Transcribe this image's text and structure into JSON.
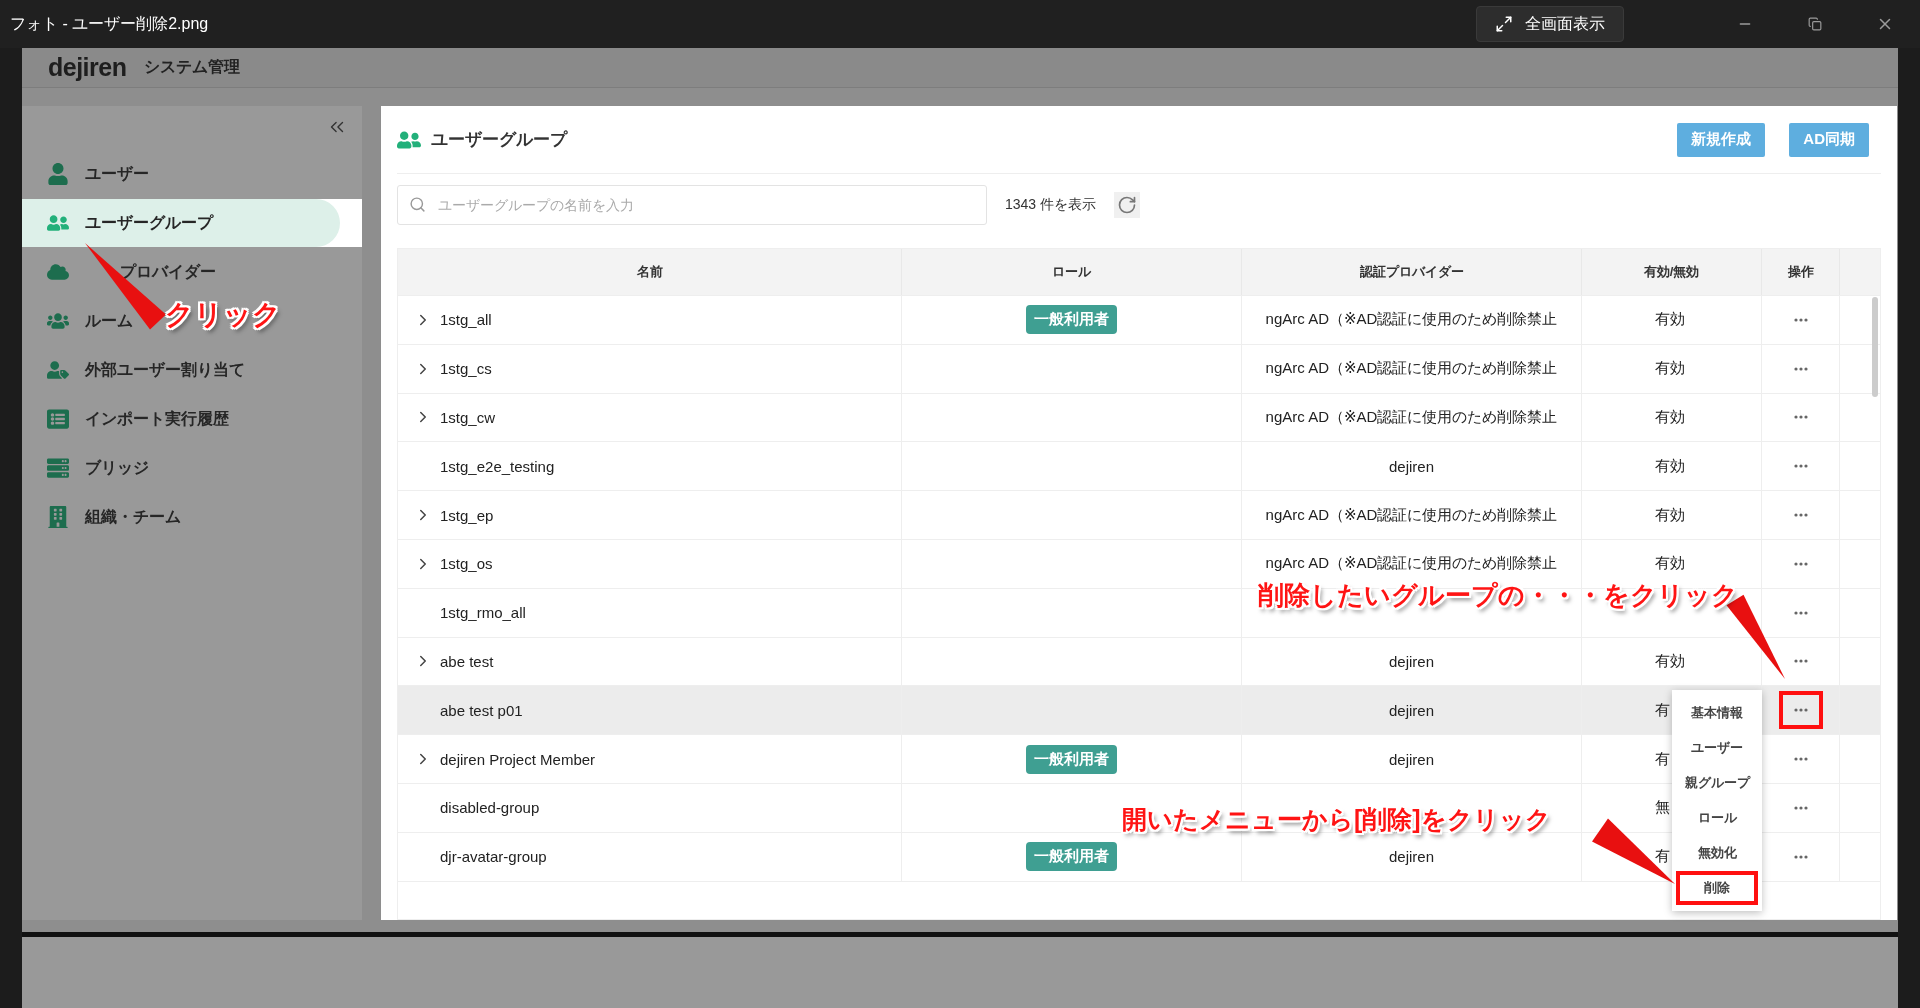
{
  "window": {
    "title": "フォト - ユーザー削除2.png",
    "fullscreen_button": "全画面表示"
  },
  "app": {
    "logo": "dejiren",
    "section": "システム管理"
  },
  "sidebar": {
    "items": [
      {
        "label": "ユーザー",
        "selected": false
      },
      {
        "label": "ユーザーグループ",
        "selected": true
      },
      {
        "label": "プロバイダー",
        "selected": false
      },
      {
        "label": "ルーム",
        "selected": false
      },
      {
        "label": "外部ユーザー割り当て",
        "selected": false
      },
      {
        "label": "インポート実行履歴",
        "selected": false
      },
      {
        "label": "ブリッジ",
        "selected": false
      },
      {
        "label": "組織・チーム",
        "selected": false
      }
    ]
  },
  "page": {
    "title": "ユーザーグループ",
    "buttons": [
      "新規作成",
      "AD同期"
    ],
    "search": {
      "placeholder": "ユーザーグループの名前を入力"
    },
    "count": "1343 件を表示"
  },
  "table": {
    "columns": [
      "名前",
      "ロール",
      "認証プロバイダー",
      "有効/無効",
      "操作"
    ],
    "rows": [
      {
        "name": "1stg_all",
        "expandable": true,
        "role": "一般利用者",
        "provider": "ngArc AD（※AD認証に使用のため削除禁止",
        "status": "有効",
        "highlighted": false,
        "ops_marked": false
      },
      {
        "name": "1stg_cs",
        "expandable": true,
        "provider": "ngArc AD（※AD認証に使用のため削除禁止",
        "status": "有効",
        "highlighted": false,
        "ops_marked": false
      },
      {
        "name": "1stg_cw",
        "expandable": true,
        "provider": "ngArc AD（※AD認証に使用のため削除禁止",
        "status": "有効",
        "highlighted": false,
        "ops_marked": false
      },
      {
        "name": "1stg_e2e_testing",
        "expandable": false,
        "provider": "dejiren",
        "status": "有効",
        "highlighted": false,
        "ops_marked": false
      },
      {
        "name": "1stg_ep",
        "expandable": true,
        "provider": "ngArc AD（※AD認証に使用のため削除禁止",
        "status": "有効",
        "highlighted": false,
        "ops_marked": false
      },
      {
        "name": "1stg_os",
        "expandable": true,
        "provider": "ngArc AD（※AD認証に使用のため削除禁止",
        "status": "有効",
        "highlighted": false,
        "ops_marked": false
      },
      {
        "name": "1stg_rmo_all",
        "expandable": false,
        "highlighted": false,
        "ops_marked": false
      },
      {
        "name": "abe test",
        "expandable": true,
        "provider": "dejiren",
        "status": "有効",
        "highlighted": false,
        "ops_marked": false
      },
      {
        "name": "abe test p01",
        "expandable": false,
        "provider": "dejiren",
        "status": "有",
        "highlighted": true,
        "ops_marked": true
      },
      {
        "name": "dejiren Project Member",
        "expandable": true,
        "role": "一般利用者",
        "provider": "dejiren",
        "status": "有",
        "highlighted": false,
        "ops_marked": false
      },
      {
        "name": "disabled-group",
        "expandable": false,
        "status": "無",
        "highlighted": false,
        "ops_marked": false
      },
      {
        "name": "djr-avatar-group",
        "expandable": false,
        "role": "一般利用者",
        "provider": "dejiren",
        "status": "有",
        "highlighted": false,
        "ops_marked": false
      }
    ]
  },
  "menu": {
    "items": [
      {
        "label": "基本情報",
        "marked": false
      },
      {
        "label": "ユーザー",
        "marked": false
      },
      {
        "label": "親グループ",
        "marked": false
      },
      {
        "label": "ロール",
        "marked": false
      },
      {
        "label": "無効化",
        "marked": false
      },
      {
        "label": "削除",
        "marked": true
      }
    ]
  },
  "annotations": [
    {
      "text": "クリック"
    },
    {
      "text": "削除したいグループの・・・をクリック"
    },
    {
      "text": "開いたメニューから[削除]をクリック"
    }
  ]
}
